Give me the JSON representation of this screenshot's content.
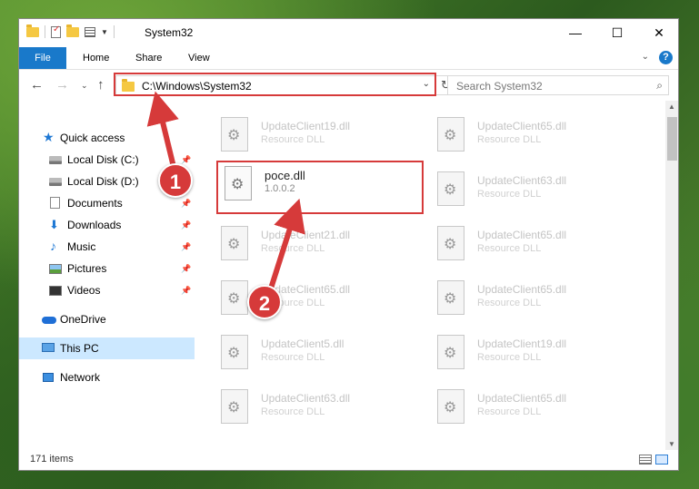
{
  "window": {
    "title": "System32",
    "controls": {
      "minimize": "—",
      "maximize": "☐",
      "close": "✕"
    }
  },
  "ribbon": {
    "tabs": [
      "File",
      "Home",
      "Share",
      "View"
    ],
    "help": "?"
  },
  "address": {
    "path": "C:\\Windows\\System32",
    "search_placeholder": "Search System32"
  },
  "nav_pane": {
    "items": [
      {
        "label": "Quick access",
        "icon": "star-icon"
      },
      {
        "label": "Local Disk (C:)",
        "icon": "drive-icon",
        "pinned": true
      },
      {
        "label": "Local Disk (D:)",
        "icon": "drive-icon",
        "pinned": true
      },
      {
        "label": "Documents",
        "icon": "documents-icon",
        "pinned": true
      },
      {
        "label": "Downloads",
        "icon": "downloads-icon",
        "pinned": true
      },
      {
        "label": "Music",
        "icon": "music-icon",
        "pinned": true
      },
      {
        "label": "Pictures",
        "icon": "pictures-icon",
        "pinned": true
      },
      {
        "label": "Videos",
        "icon": "videos-icon",
        "pinned": true
      },
      {
        "label": "OneDrive",
        "icon": "onedrive-icon"
      },
      {
        "label": "This PC",
        "icon": "this-pc-icon",
        "selected": true
      },
      {
        "label": "Network",
        "icon": "network-icon"
      }
    ]
  },
  "files": [
    {
      "name": "UpdateClient19.dll",
      "type": "Resource DLL"
    },
    {
      "name": "UpdateClient65.dll",
      "type": "Resource DLL"
    },
    {
      "name": "poce.dll",
      "type": "1.0.0.2"
    },
    {
      "name": "UpdateClient63.dll",
      "type": "Resource DLL"
    },
    {
      "name": "UpdateClient21.dll",
      "type": "Resource DLL"
    },
    {
      "name": "UpdateClient65.dll",
      "type": "Resource DLL"
    },
    {
      "name": "UpdateClient65.dll",
      "type": "Resource DLL"
    },
    {
      "name": "UpdateClient65.dll",
      "type": "Resource DLL"
    },
    {
      "name": "UpdateClient5.dll",
      "type": "Resource DLL"
    },
    {
      "name": "UpdateClient19.dll",
      "type": "Resource DLL"
    },
    {
      "name": "UpdateClient63.dll",
      "type": "Resource DLL"
    },
    {
      "name": "UpdateClient65.dll",
      "type": "Resource DLL"
    }
  ],
  "status": {
    "item_count": "171 items"
  },
  "annotations": {
    "step1": "1",
    "step2": "2",
    "color": "#d63a3a"
  }
}
